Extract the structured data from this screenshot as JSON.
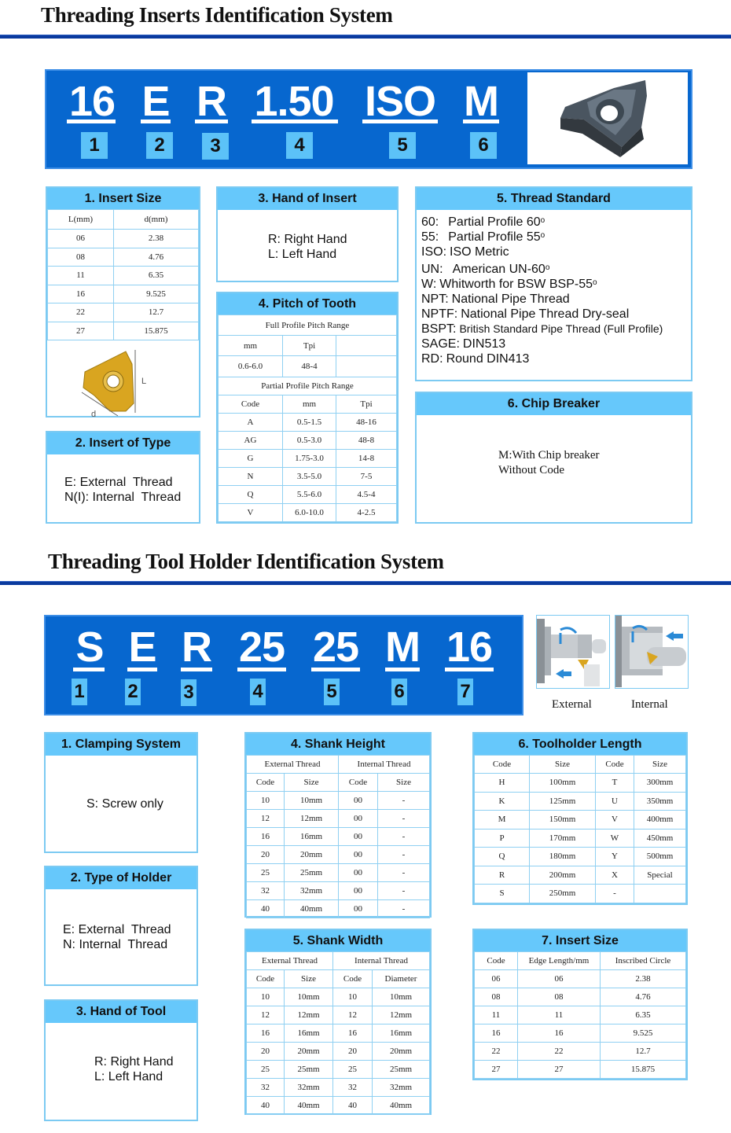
{
  "inserts": {
    "title": "Threading Inserts Identification System",
    "code": [
      {
        "text": "16",
        "num": "1"
      },
      {
        "text": "E",
        "num": "2"
      },
      {
        "text": "R",
        "num": "3"
      },
      {
        "text": "1.50",
        "num": "4"
      },
      {
        "text": "ISO",
        "num": "5"
      },
      {
        "text": "M",
        "num": "6"
      }
    ],
    "insert_size": {
      "heading": "1. Insert Size",
      "columns": [
        "L(mm)",
        "d(mm)"
      ],
      "rows": [
        [
          "06",
          "2.38"
        ],
        [
          "08",
          "4.76"
        ],
        [
          "11",
          "6.35"
        ],
        [
          "16",
          "9.525"
        ],
        [
          "22",
          "12.7"
        ],
        [
          "27",
          "15.875"
        ]
      ],
      "diagram_labels": {
        "length": "L",
        "diameter": "d"
      }
    },
    "insert_type": {
      "heading": "2. Insert of Type",
      "lines": [
        "E: External  Thread",
        "N(I): Internal  Thread"
      ]
    },
    "hand": {
      "heading": "3. Hand of Insert",
      "lines": [
        "R: Right Hand",
        "L: Left Hand"
      ]
    },
    "pitch": {
      "heading": "4. Pitch of Tooth",
      "full_profile_label": "Full Profile Pitch Range",
      "full_columns": [
        "mm",
        "Tpi",
        ""
      ],
      "full_rows": [
        [
          "0.6-6.0",
          "48-4",
          ""
        ]
      ],
      "partial_profile_label": "Partial Profile Pitch Range",
      "partial_columns": [
        "Code",
        "mm",
        "Tpi"
      ],
      "partial_rows": [
        [
          "A",
          "0.5-1.5",
          "48-16"
        ],
        [
          "AG",
          "0.5-3.0",
          "48-8"
        ],
        [
          "G",
          "1.75-3.0",
          "14-8"
        ],
        [
          "N",
          "3.5-5.0",
          "7-5"
        ],
        [
          "Q",
          "5.5-6.0",
          "4.5-4"
        ],
        [
          "V",
          "6.0-10.0",
          "4-2.5"
        ]
      ]
    },
    "thread_standard": {
      "heading": "5. Thread Standard",
      "lines": [
        {
          "code": "60:",
          "desc": "Partial Profile 60",
          "deg": "o"
        },
        {
          "code": "55:",
          "desc": "Partial Profile 55",
          "deg": "o"
        },
        {
          "code": "ISO:",
          "desc": "ISO Metric",
          "deg": ""
        },
        {
          "code": "UN:",
          "desc": "American UN-60",
          "deg": "o"
        },
        {
          "code": "W:",
          "desc": "Whitworth for BSW BSP-55",
          "deg": "o"
        },
        {
          "code": "NPT:",
          "desc": "National Pipe Thread",
          "deg": ""
        },
        {
          "code": "NPTF:",
          "desc": "National Pipe Thread Dry-seal",
          "deg": ""
        },
        {
          "code": "BSPT:",
          "desc": "British Standard Pipe Thread (Full Profile)",
          "deg": ""
        },
        {
          "code": "SAGE:",
          "desc": "DIN513",
          "deg": ""
        },
        {
          "code": "RD:",
          "desc": "Round DIN413",
          "deg": ""
        }
      ]
    },
    "chip_breaker": {
      "heading": "6. Chip Breaker",
      "lines": [
        "M:With Chip breaker",
        "Without Code"
      ]
    }
  },
  "holders": {
    "title": "Threading Tool Holder Identification System",
    "code": [
      {
        "text": "S",
        "num": "1"
      },
      {
        "text": "E",
        "num": "2"
      },
      {
        "text": "R",
        "num": "3"
      },
      {
        "text": "25",
        "num": "4"
      },
      {
        "text": "25",
        "num": "5"
      },
      {
        "text": "M",
        "num": "6"
      },
      {
        "text": "16",
        "num": "7"
      }
    ],
    "illustrations": {
      "external": "External",
      "internal": "Internal"
    },
    "clamping": {
      "heading": "1. Clamping System",
      "lines": [
        "S: Screw only"
      ]
    },
    "holder_type": {
      "heading": "2. Type of Holder",
      "lines": [
        "E: External  Thread",
        "N: Internal  Thread"
      ]
    },
    "hand": {
      "heading": "3. Hand of Tool",
      "lines": [
        "R: Right Hand",
        "L: Left Hand"
      ]
    },
    "shank_height": {
      "heading": "4. Shank Height",
      "groups": [
        "External Thread",
        "Internal Thread"
      ],
      "columns": [
        "Code",
        "Size",
        "Code",
        "Size"
      ],
      "rows": [
        [
          "10",
          "10mm",
          "00",
          "-"
        ],
        [
          "12",
          "12mm",
          "00",
          "-"
        ],
        [
          "16",
          "16mm",
          "00",
          "-"
        ],
        [
          "20",
          "20mm",
          "00",
          "-"
        ],
        [
          "25",
          "25mm",
          "00",
          "-"
        ],
        [
          "32",
          "32mm",
          "00",
          "-"
        ],
        [
          "40",
          "40mm",
          "00",
          "-"
        ]
      ]
    },
    "shank_width": {
      "heading": "5. Shank Width",
      "groups": [
        "External Thread",
        "Internal Thread"
      ],
      "columns": [
        "Code",
        "Size",
        "Code",
        "Diameter"
      ],
      "rows": [
        [
          "10",
          "10mm",
          "10",
          "10mm"
        ],
        [
          "12",
          "12mm",
          "12",
          "12mm"
        ],
        [
          "16",
          "16mm",
          "16",
          "16mm"
        ],
        [
          "20",
          "20mm",
          "20",
          "20mm"
        ],
        [
          "25",
          "25mm",
          "25",
          "25mm"
        ],
        [
          "32",
          "32mm",
          "32",
          "32mm"
        ],
        [
          "40",
          "40mm",
          "40",
          "40mm"
        ]
      ]
    },
    "length": {
      "heading": "6. Toolholder Length",
      "columns": [
        "Code",
        "Size",
        "Code",
        "Size"
      ],
      "rows": [
        [
          "H",
          "100mm",
          "T",
          "300mm"
        ],
        [
          "K",
          "125mm",
          "U",
          "350mm"
        ],
        [
          "M",
          "150mm",
          "V",
          "400mm"
        ],
        [
          "P",
          "170mm",
          "W",
          "450mm"
        ],
        [
          "Q",
          "180mm",
          "Y",
          "500mm"
        ],
        [
          "R",
          "200mm",
          "X",
          "Special"
        ],
        [
          "S",
          "250mm",
          "-",
          ""
        ]
      ]
    },
    "insert_size": {
      "heading": "7. Insert Size",
      "columns": [
        "Code",
        "Edge Length/mm",
        "Inscribed Circle"
      ],
      "rows": [
        [
          "06",
          "06",
          "2.38"
        ],
        [
          "08",
          "08",
          "4.76"
        ],
        [
          "11",
          "11",
          "6.35"
        ],
        [
          "16",
          "16",
          "9.525"
        ],
        [
          "22",
          "22",
          "12.7"
        ],
        [
          "27",
          "27",
          "15.875"
        ]
      ]
    }
  }
}
